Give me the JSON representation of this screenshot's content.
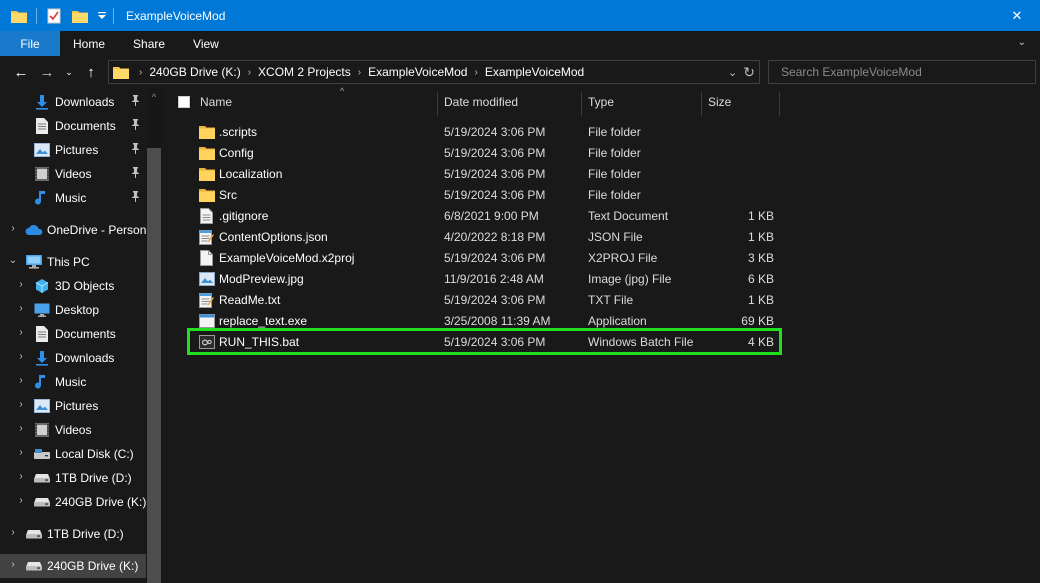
{
  "window": {
    "title": "ExampleVoiceMod",
    "close_glyph": "✕"
  },
  "ribbon": {
    "tabs": [
      "File",
      "Home",
      "Share",
      "View"
    ],
    "expand_glyph": "⌄"
  },
  "nav": {
    "back": "←",
    "forward": "→",
    "recent": "⌄",
    "up": "↑"
  },
  "address": {
    "crumbs": [
      "240GB Drive (K:)",
      "XCOM 2 Projects",
      "ExampleVoiceMod",
      "ExampleVoiceMod"
    ],
    "dropdown_glyph": "⌄",
    "refresh_glyph": "↻"
  },
  "search": {
    "placeholder": "Search ExampleVoiceMod"
  },
  "sidebar": {
    "items": [
      {
        "label": "Downloads",
        "icon": "download-icon",
        "indent": 0,
        "chevron": "",
        "pinned": true
      },
      {
        "label": "Documents",
        "icon": "documents-icon",
        "indent": 0,
        "chevron": "",
        "pinned": true
      },
      {
        "label": "Pictures",
        "icon": "pictures-icon",
        "indent": 0,
        "chevron": "",
        "pinned": true
      },
      {
        "label": "Videos",
        "icon": "videos-icon",
        "indent": 0,
        "chevron": "",
        "pinned": true
      },
      {
        "label": "Music",
        "icon": "music-icon",
        "indent": 0,
        "chevron": "",
        "pinned": true
      },
      {
        "label": "OneDrive - Persona",
        "icon": "onedrive-icon",
        "indent": -1,
        "chevron": "›",
        "pinned": false
      },
      {
        "label": "This PC",
        "icon": "this-pc-icon",
        "indent": -1,
        "chevron": "⌄",
        "pinned": false
      },
      {
        "label": "3D Objects",
        "icon": "3d-objects-icon",
        "indent": 0,
        "chevron": "›",
        "pinned": false
      },
      {
        "label": "Desktop",
        "icon": "desktop-icon",
        "indent": 0,
        "chevron": "›",
        "pinned": false
      },
      {
        "label": "Documents",
        "icon": "documents-icon",
        "indent": 0,
        "chevron": "›",
        "pinned": false
      },
      {
        "label": "Downloads",
        "icon": "download-icon",
        "indent": 0,
        "chevron": "›",
        "pinned": false
      },
      {
        "label": "Music",
        "icon": "music-icon",
        "indent": 0,
        "chevron": "›",
        "pinned": false
      },
      {
        "label": "Pictures",
        "icon": "pictures-icon",
        "indent": 0,
        "chevron": "›",
        "pinned": false
      },
      {
        "label": "Videos",
        "icon": "videos-icon",
        "indent": 0,
        "chevron": "›",
        "pinned": false
      },
      {
        "label": "Local Disk (C:)",
        "icon": "local-disk-icon",
        "indent": 0,
        "chevron": "›",
        "pinned": false
      },
      {
        "label": "1TB Drive (D:)",
        "icon": "drive-icon",
        "indent": 0,
        "chevron": "›",
        "pinned": false
      },
      {
        "label": "240GB Drive (K:)",
        "icon": "drive-icon",
        "indent": 0,
        "chevron": "›",
        "pinned": false
      },
      {
        "label": "1TB Drive (D:)",
        "icon": "drive-icon",
        "indent": -1,
        "chevron": "›",
        "pinned": false
      },
      {
        "label": "240GB Drive (K:)",
        "icon": "drive-icon",
        "indent": -1,
        "chevron": "›",
        "pinned": false,
        "selected": true
      }
    ],
    "pin_glyph": "📌"
  },
  "columns": {
    "name": "Name",
    "date": "Date modified",
    "type": "Type",
    "size": "Size",
    "sort_glyph": "^"
  },
  "files": [
    {
      "name": ".scripts",
      "date": "5/19/2024 3:06 PM",
      "type": "File folder",
      "size": "",
      "icon": "folder-icon"
    },
    {
      "name": "Config",
      "date": "5/19/2024 3:06 PM",
      "type": "File folder",
      "size": "",
      "icon": "folder-icon"
    },
    {
      "name": "Localization",
      "date": "5/19/2024 3:06 PM",
      "type": "File folder",
      "size": "",
      "icon": "folder-icon"
    },
    {
      "name": "Src",
      "date": "5/19/2024 3:06 PM",
      "type": "File folder",
      "size": "",
      "icon": "folder-icon"
    },
    {
      "name": ".gitignore",
      "date": "6/8/2021 9:00 PM",
      "type": "Text Document",
      "size": "1 KB",
      "icon": "text-file-icon"
    },
    {
      "name": "ContentOptions.json",
      "date": "4/20/2022 8:18 PM",
      "type": "JSON File",
      "size": "1 KB",
      "icon": "notepad-file-icon"
    },
    {
      "name": "ExampleVoiceMod.x2proj",
      "date": "5/19/2024 3:06 PM",
      "type": "X2PROJ File",
      "size": "3 KB",
      "icon": "generic-file-icon"
    },
    {
      "name": "ModPreview.jpg",
      "date": "11/9/2016 2:48 AM",
      "type": "Image (jpg) File",
      "size": "6 KB",
      "icon": "image-file-icon"
    },
    {
      "name": "ReadMe.txt",
      "date": "5/19/2024 3:06 PM",
      "type": "TXT File",
      "size": "1 KB",
      "icon": "notepad-file-icon"
    },
    {
      "name": "replace_text.exe",
      "date": "3/25/2008 11:39 AM",
      "type": "Application",
      "size": "69 KB",
      "icon": "exe-file-icon"
    },
    {
      "name": "RUN_THIS.bat",
      "date": "5/19/2024 3:06 PM",
      "type": "Windows Batch File",
      "size": "4 KB",
      "icon": "batch-file-icon",
      "highlighted": true
    }
  ],
  "colors": {
    "titlebar": "#0078d7",
    "file_tab": "#1979ca",
    "highlight": "#20e020",
    "folder": "#f5c64c",
    "background": "#191919"
  }
}
